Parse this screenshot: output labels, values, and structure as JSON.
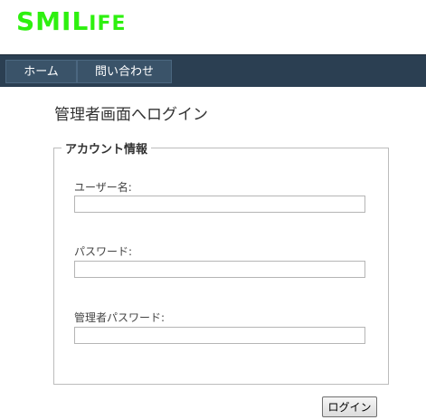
{
  "logo": {
    "main": "SMIL",
    "tail": "IFE"
  },
  "nav": {
    "home": "ホーム",
    "contact": "問い合わせ"
  },
  "page_title": "管理者画面へログイン",
  "form": {
    "legend": "アカウント情報",
    "username_label": "ユーザー名:",
    "username_value": "",
    "password_label": "パスワード:",
    "password_value": "",
    "admin_password_label": "管理者パスワード:",
    "admin_password_value": "",
    "submit_label": "ログイン"
  },
  "colors": {
    "logo": "#2ef00f",
    "navbar": "#2b3f52",
    "nav_item": "#3a5369"
  }
}
